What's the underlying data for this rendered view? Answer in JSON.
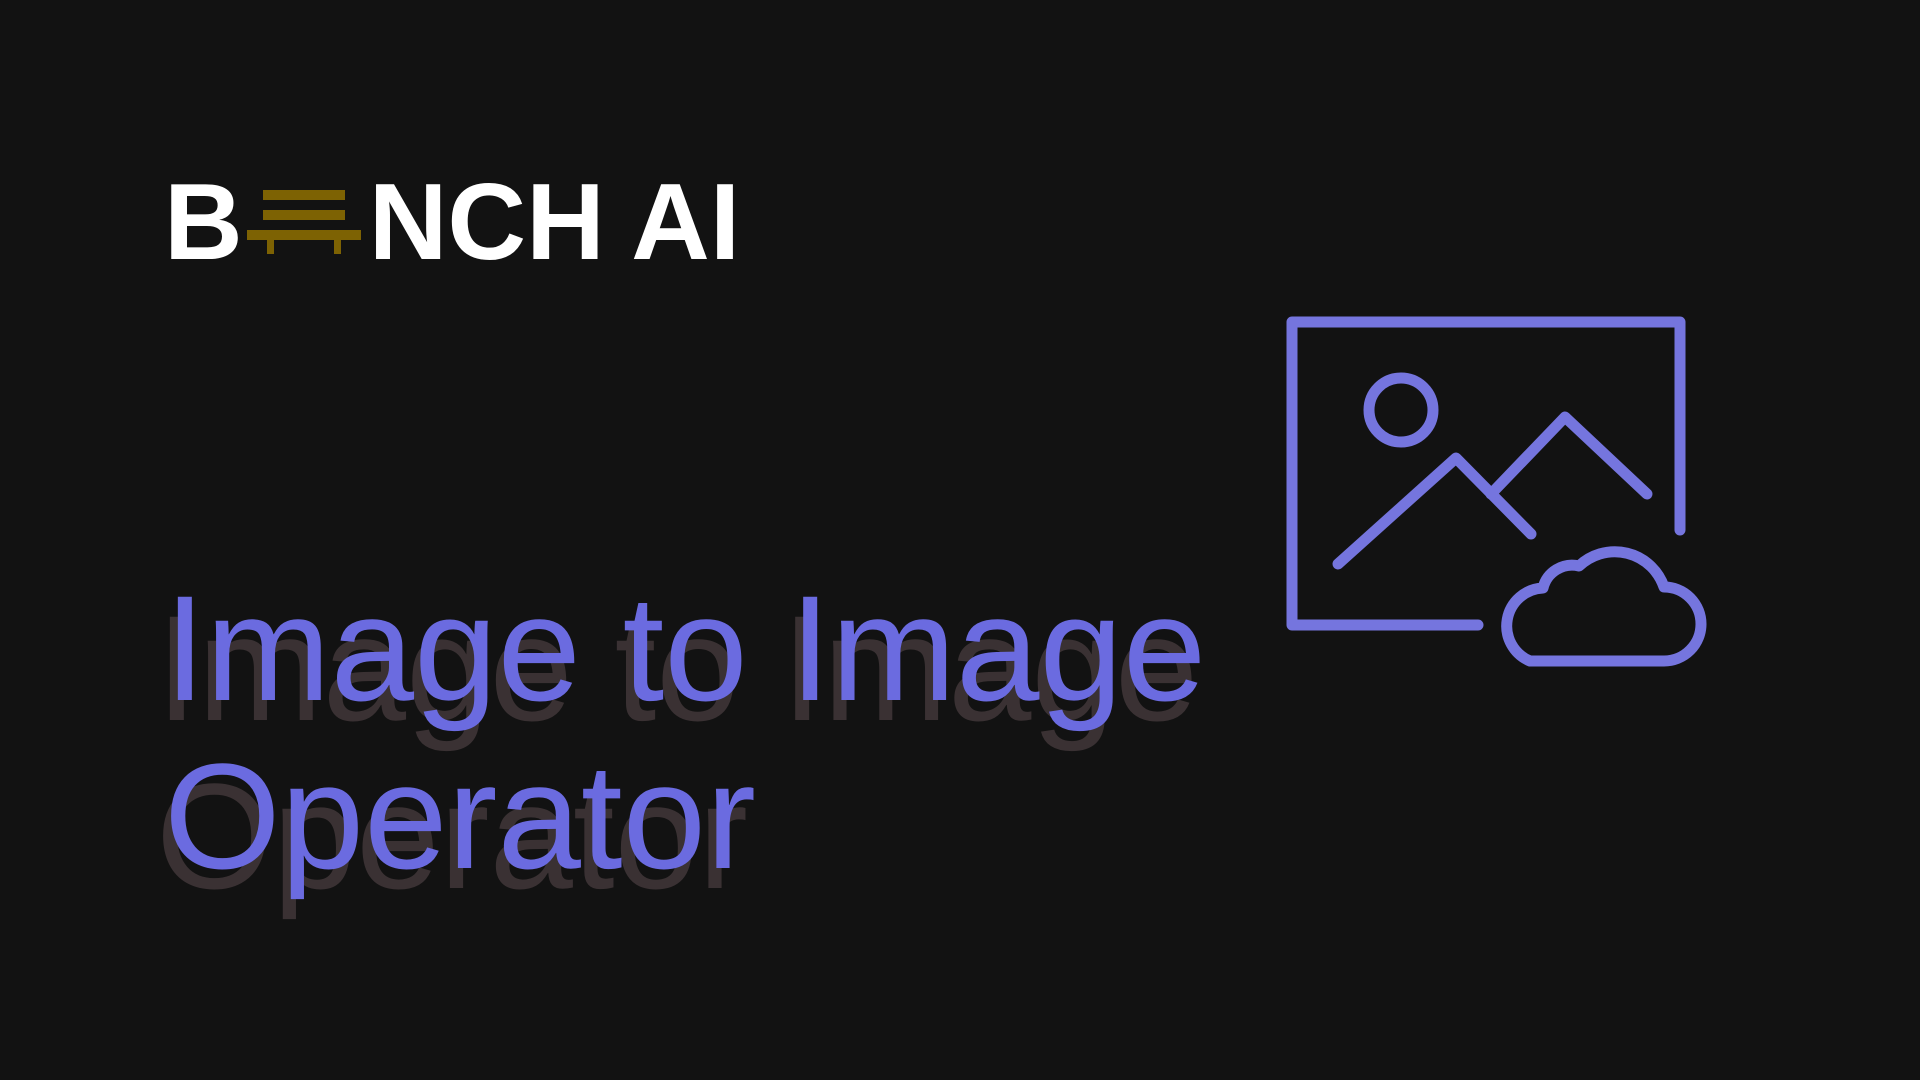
{
  "logo": {
    "text_before": "B",
    "text_after": "NCH AI",
    "mark_icon": "bench-icon",
    "mark_color": "#7d6203",
    "text_color": "#ffffff"
  },
  "title": {
    "line1": "Image to Image",
    "line2": "Operator",
    "color": "#6b6be0",
    "shadow_color": "#3a3133"
  },
  "hero_icon": {
    "name": "image-cloud-icon",
    "color": "#7575de"
  },
  "background": "#121212"
}
